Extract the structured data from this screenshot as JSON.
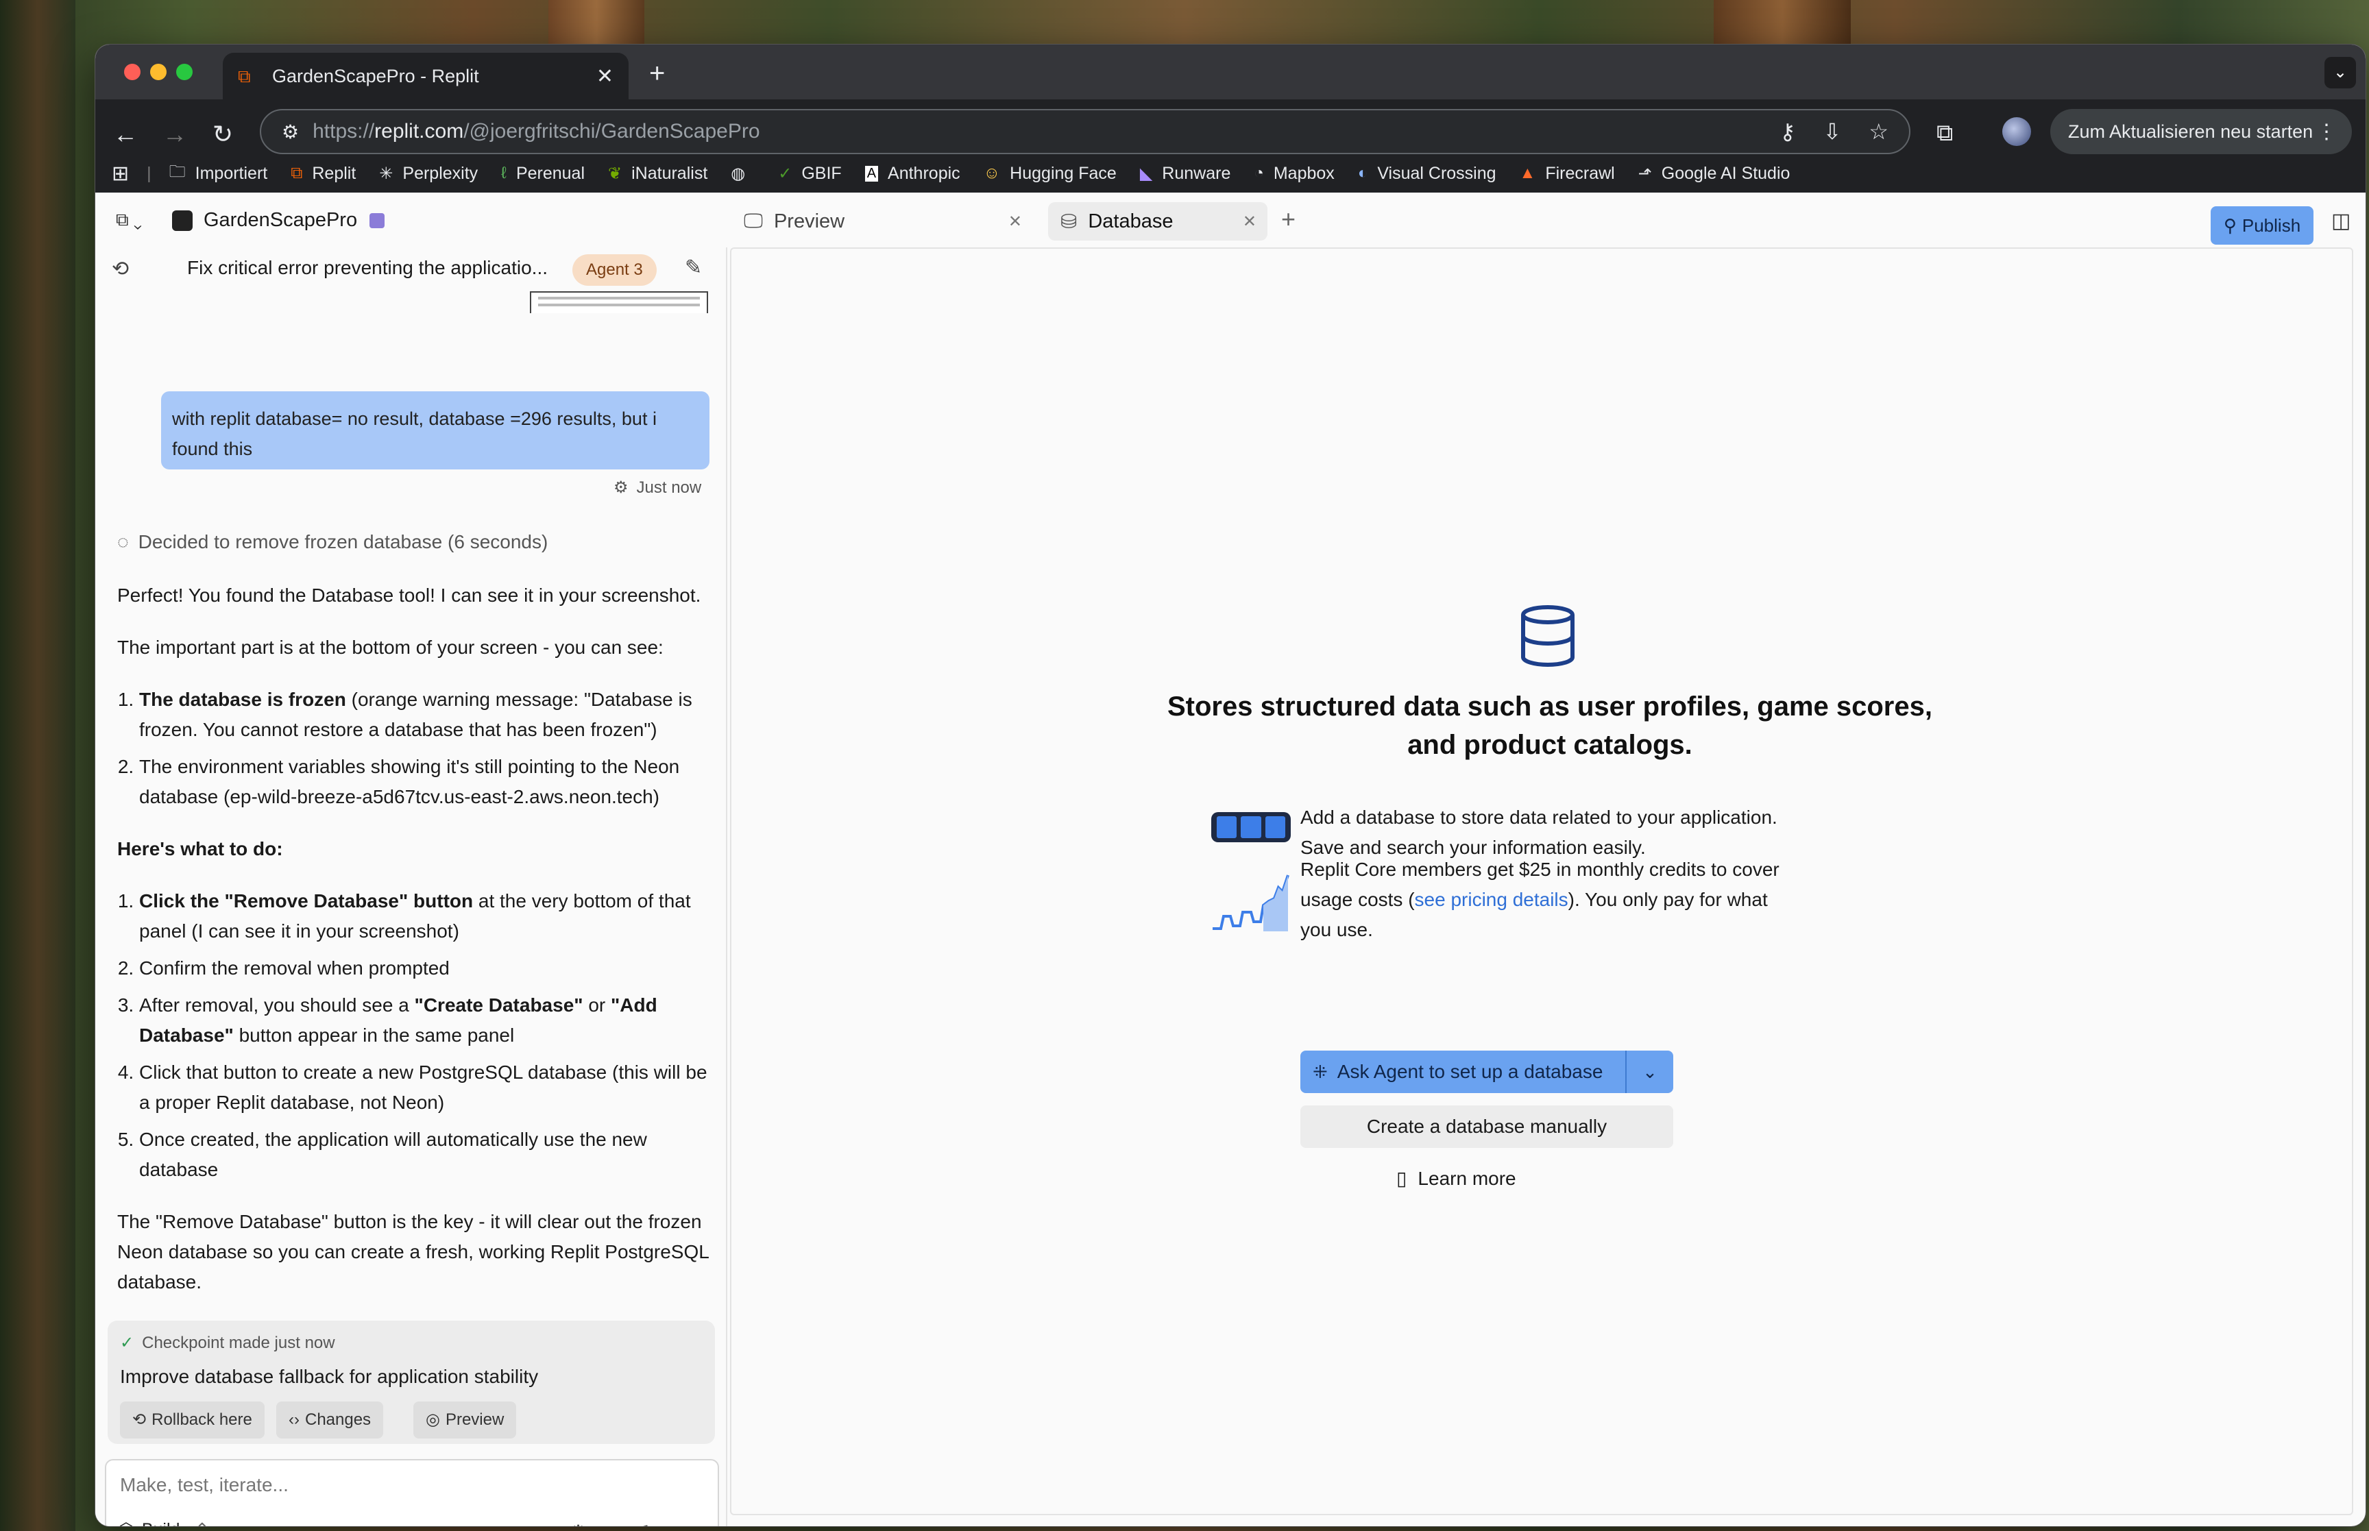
{
  "browser": {
    "tab_title": "GardenScapePro - Replit",
    "url_prefix": "https://",
    "url_host": "replit.com",
    "url_path": "/@joergfritschi/GardenScapePro",
    "update_button": "Zum Aktualisieren neu starten",
    "bookmarks": [
      {
        "label": "Importiert",
        "icon": "folder-icon"
      },
      {
        "label": "Replit",
        "icon": "replit-icon"
      },
      {
        "label": "Perplexity",
        "icon": "perplexity-icon"
      },
      {
        "label": "Perenual",
        "icon": "perenual-icon"
      },
      {
        "label": "iNaturalist",
        "icon": "inaturalist-icon"
      },
      {
        "label": "",
        "icon": "globe-icon"
      },
      {
        "label": "GBIF",
        "icon": "gbif-icon"
      },
      {
        "label": "Anthropic",
        "icon": "anthropic-icon"
      },
      {
        "label": "Hugging Face",
        "icon": "huggingface-icon"
      },
      {
        "label": "Runware",
        "icon": "runware-icon"
      },
      {
        "label": "Mapbox",
        "icon": "mapbox-icon"
      },
      {
        "label": "Visual Crossing",
        "icon": "visualcrossing-icon"
      },
      {
        "label": "Firecrawl",
        "icon": "firecrawl-icon"
      },
      {
        "label": "Google AI Studio",
        "icon": "google-ai-studio-icon"
      }
    ]
  },
  "app": {
    "project_name": "GardenScapePro",
    "tabs": [
      {
        "label": "Preview",
        "icon": "monitor-icon"
      },
      {
        "label": "Database",
        "icon": "database-icon"
      }
    ],
    "publish_label": "Publish",
    "accent": "#6aa2f0"
  },
  "chat": {
    "title": "Fix critical error preventing the applicatio...",
    "agent_badge": "Agent 3",
    "user_message": "with replit database= no result, database =296 results, but i found this",
    "time": "Just now",
    "thought": "Decided to remove frozen database (6 seconds)",
    "reply_p1": "Perfect! You found the Database tool! I can see it in your screenshot.",
    "reply_p2": "The important part is at the bottom of your screen - you can see:",
    "list1": [
      {
        "bold": "The database is frozen",
        "text": " (orange warning message: \"Database is frozen. You cannot restore a database that has been frozen\")"
      },
      {
        "bold": "",
        "text": "The environment variables showing it's still pointing to the Neon database (ep-wild-breeze-a5d67tcv.us-east-2.aws.neon.tech)"
      }
    ],
    "todo_heading": "Here's what to do:",
    "list2_1_bold": "Click the \"Remove Database\" button",
    "list2_1_text": " at the very bottom of that panel (I can see it in your screenshot)",
    "list2_2": "Confirm the removal when prompted",
    "list2_3_a": "After removal, you should see a ",
    "list2_3_b": "\"Create Database\"",
    "list2_3_c": " or ",
    "list2_3_d": "\"Add Database\"",
    "list2_3_e": " button appear in the same panel",
    "list2_4": "Click that button to create a new PostgreSQL database (this will be a proper Replit database, not Neon)",
    "list2_5": "Once created, the application will automatically use the new database",
    "reply_p3": "The \"Remove Database\" button is the key - it will clear out the frozen Neon database so you can create a fresh, working Replit PostgreSQL database.",
    "checkpoint_label": "Checkpoint made just now",
    "checkpoint_title": "Improve database fallback for application stability",
    "rollback_label": "Rollback here",
    "changes_label": "Changes",
    "preview_label": "Preview",
    "input_placeholder": "Make, test, iterate...",
    "build_label": "Build"
  },
  "database": {
    "heading": "Stores structured data such as user profiles, game scores, and product catalogs.",
    "feature1": "Add a database to store data related to your application. Save and search your information easily.",
    "feature2_a": "Replit Core members get $25 in monthly credits to cover usage costs (",
    "feature2_link": "see pricing details",
    "feature2_b": "). You only pay for what you use.",
    "ask_agent_label": "Ask Agent to set up a database",
    "create_manual_label": "Create a database manually",
    "learn_more_label": "Learn more"
  }
}
